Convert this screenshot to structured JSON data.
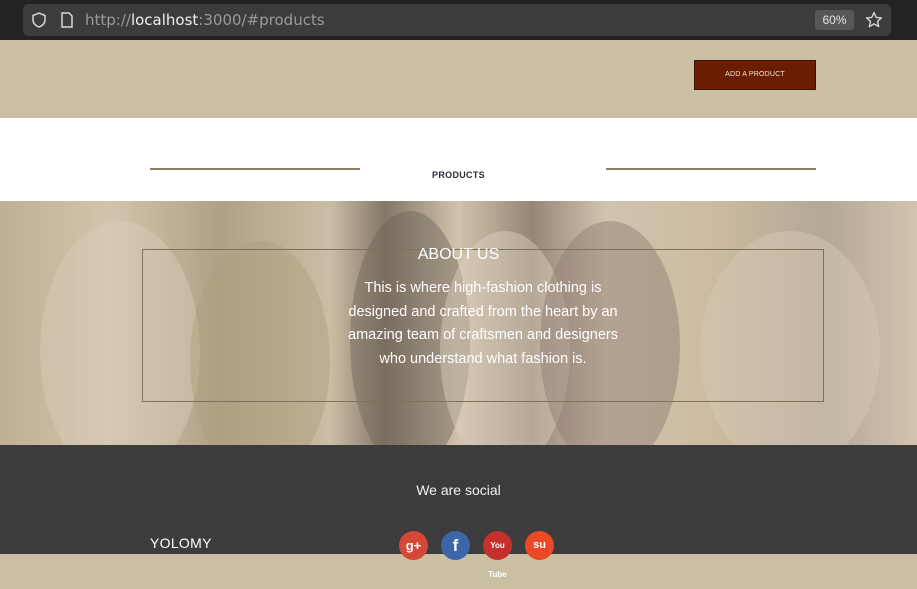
{
  "browser": {
    "url_scheme": "http://",
    "url_host": "localhost",
    "url_rest": ":3000/#products",
    "zoom": "60%"
  },
  "header": {
    "add_product_label": "ADD A PRODUCT"
  },
  "products": {
    "title": "PRODUCTS"
  },
  "about": {
    "title": "ABOUT US",
    "text": "This is where high-fashion clothing is designed and crafted from the heart by an amazing team of craftsmen and designers who understand what fashion is."
  },
  "footer": {
    "social_title": "We are social",
    "brand": "YOLOMY",
    "social_icons": [
      "google-plus-icon",
      "facebook-icon",
      "youtube-icon",
      "stumbleupon-icon"
    ],
    "social_glyphs": {
      "google_plus": "g+",
      "facebook": "f",
      "youtube": "You Tube",
      "stumbleupon": "su"
    }
  },
  "colors": {
    "header_bg": "#cbbfa3",
    "accent_button": "#6b1d00",
    "rule": "#8e7f5d",
    "footer_bg": "#3c3c3c"
  }
}
